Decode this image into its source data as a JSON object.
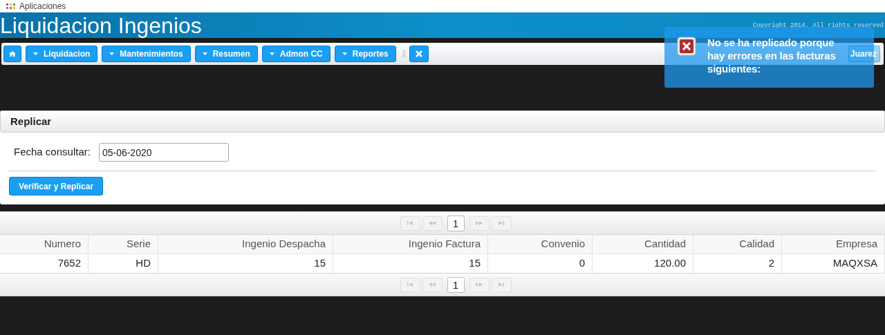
{
  "bookmarks_bar": {
    "label": "Aplicaciones"
  },
  "header": {
    "title": "Liquidacion Ingenios",
    "copyright": "Copyright 2014. All rights reserved"
  },
  "toolbar": {
    "menus": [
      "Liquidacion",
      "Mantenimientos",
      "Resumen",
      "Admon CC",
      "Reportes"
    ],
    "user": "Juarez"
  },
  "toast": {
    "message": "No se ha replicado porque hay errores en las facturas siguientes:"
  },
  "panel": {
    "title": "Replicar",
    "field_label": "Fecha consultar:",
    "field_value": "05-06-2020",
    "button": "Verificar y Replicar"
  },
  "table": {
    "pagers": [
      {
        "pages": [
          {
            "label": "1",
            "selected": true
          }
        ]
      },
      {
        "pages": [
          {
            "label": "1",
            "selected": true
          }
        ]
      }
    ],
    "columns": [
      "Numero",
      "Serie",
      "Ingenio Despacha",
      "Ingenio Factura",
      "Convenio",
      "Cantidad",
      "Calidad",
      "Empresa"
    ],
    "rows": [
      [
        "7652",
        "HD",
        "15",
        "15",
        "0",
        "120.00",
        "2",
        "MAQXSA"
      ]
    ]
  }
}
